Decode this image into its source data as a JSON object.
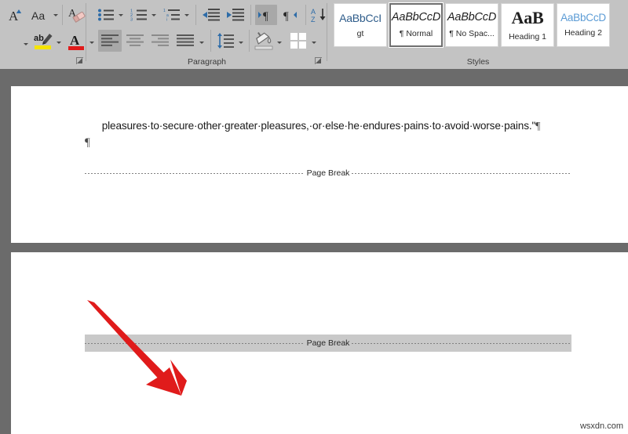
{
  "ribbon": {
    "groups": [
      {
        "id": "font",
        "label": ""
      },
      {
        "id": "paragraph",
        "label": "Paragraph"
      },
      {
        "id": "styles",
        "label": "Styles"
      }
    ],
    "font_group": {
      "buttons": [
        {
          "name": "increase-font-size",
          "tip": "Increase Font Size",
          "glyph": "A"
        },
        {
          "name": "change-case",
          "tip": "Change Case",
          "glyph": "Aa"
        },
        {
          "name": "clear-all-formatting",
          "tip": "Clear All Formatting",
          "glyph": "A"
        },
        {
          "name": "text-highlight-color",
          "tip": "Text Highlight Color",
          "glyph": "ab"
        },
        {
          "name": "font-color",
          "tip": "Font Color",
          "glyph": "A"
        }
      ]
    },
    "paragraph_group": {
      "label": "Paragraph",
      "buttons": [
        {
          "name": "bullets",
          "tip": "Bullets"
        },
        {
          "name": "numbering",
          "tip": "Numbering"
        },
        {
          "name": "multilevel-list",
          "tip": "Multilevel List"
        },
        {
          "name": "decrease-indent",
          "tip": "Decrease Indent"
        },
        {
          "name": "increase-indent",
          "tip": "Increase Indent"
        },
        {
          "name": "left-to-right-text-direction",
          "tip": "Left-to-Right Text Direction",
          "active": true
        },
        {
          "name": "right-to-left-text-direction",
          "tip": "Right-to-Left Text Direction",
          "active": false
        },
        {
          "name": "sort",
          "tip": "Sort"
        },
        {
          "name": "show-hide-formatting-marks",
          "tip": "Show/Hide ¶",
          "active": true
        },
        {
          "name": "align-left",
          "tip": "Align Left",
          "active": true
        },
        {
          "name": "center",
          "tip": "Center",
          "active": false
        },
        {
          "name": "align-right",
          "tip": "Align Right",
          "active": false
        },
        {
          "name": "justify",
          "tip": "Justify",
          "active": false
        },
        {
          "name": "line-and-paragraph-spacing",
          "tip": "Line and Paragraph Spacing"
        },
        {
          "name": "shading",
          "tip": "Shading"
        },
        {
          "name": "borders",
          "tip": "Borders"
        }
      ]
    },
    "styles_group": {
      "label": "Styles",
      "items": [
        {
          "preview": "AaBbCcI",
          "name": "gt",
          "selected": false,
          "kind": "blue"
        },
        {
          "preview": "AaBbCcD",
          "name": "¶ Normal",
          "selected": true,
          "kind": "ital"
        },
        {
          "preview": "AaBbCcD",
          "name": "¶ No Spac...",
          "selected": false,
          "kind": "ital"
        },
        {
          "preview": "AaB",
          "name": "Heading 1",
          "selected": false,
          "kind": "h1"
        },
        {
          "preview": "AaBbCcD",
          "name": "Heading 2",
          "selected": false,
          "kind": "h2"
        }
      ]
    }
  },
  "document": {
    "page1": {
      "body_text": "pleasures·to·secure·other·greater·pleasures,·or·else·he·endures·pains·to·avoid·worse·pains.\"",
      "end_mark": "¶",
      "empty_paragraph_mark": "¶",
      "page_break_label": "Page Break"
    },
    "page2": {
      "page_break_label": "Page Break",
      "page_break_selected": true
    }
  },
  "annotation": {
    "arrow_color": "#e01b1b",
    "arrow_from": "113,302",
    "arrow_to": "226,413"
  },
  "watermark": {
    "text": "wsxdn.com"
  },
  "colors": {
    "ribbon_bg": "#c3c3c3",
    "canvas_bg": "#6b6b6b",
    "page_bg": "#ffffff",
    "selection_gray": "#c9c9c9",
    "accent_blue": "#2e5c8a",
    "arrow_red": "#e01b1b"
  }
}
